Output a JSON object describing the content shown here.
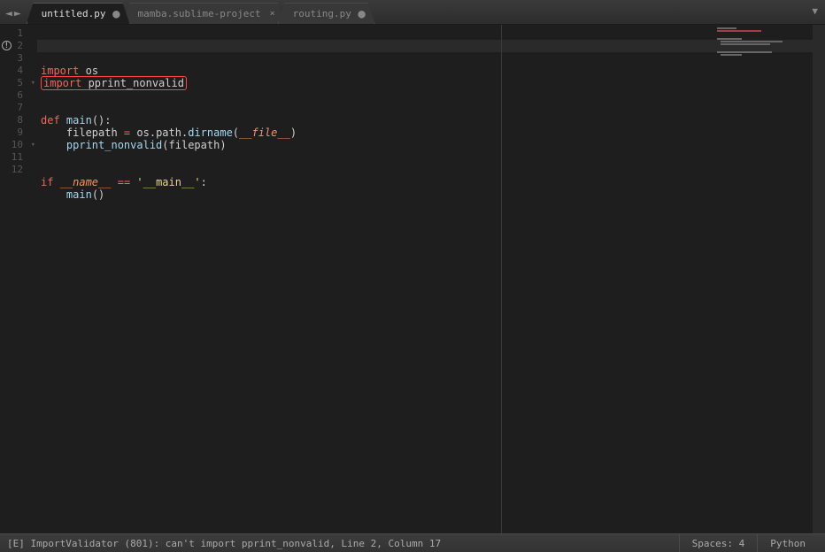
{
  "tabs": [
    {
      "label": "untitled.py",
      "active": true,
      "dirty": true
    },
    {
      "label": "mamba.sublime-project",
      "active": false,
      "dirty": false
    },
    {
      "label": "routing.py",
      "active": false,
      "dirty": true
    }
  ],
  "gutter": {
    "lines": [
      "1",
      "2",
      "3",
      "4",
      "5",
      "6",
      "7",
      "8",
      "9",
      "10",
      "11",
      "12"
    ],
    "error_line": 2
  },
  "code": {
    "active_line": 2,
    "tokens": [
      [
        {
          "t": "import",
          "c": "kw"
        },
        {
          "t": " ",
          "c": ""
        },
        {
          "t": "os",
          "c": "nm"
        }
      ],
      [
        {
          "t": "import pprint_nonvalid",
          "c": "err"
        }
      ],
      [],
      [],
      [
        {
          "t": "def",
          "c": "kw"
        },
        {
          "t": " ",
          "c": ""
        },
        {
          "t": "main",
          "c": "fn"
        },
        {
          "t": "()",
          "c": "paren"
        },
        {
          "t": ":",
          "c": "punct"
        }
      ],
      [
        {
          "t": "    filepath ",
          "c": "nm"
        },
        {
          "t": "=",
          "c": "op"
        },
        {
          "t": " os",
          "c": "nm"
        },
        {
          "t": ".",
          "c": "punct"
        },
        {
          "t": "path",
          "c": "nm"
        },
        {
          "t": ".",
          "c": "punct"
        },
        {
          "t": "dirname",
          "c": "fn"
        },
        {
          "t": "(",
          "c": "paren"
        },
        {
          "t": "__file__",
          "c": "var"
        },
        {
          "t": ")",
          "c": "paren"
        }
      ],
      [
        {
          "t": "    ",
          "c": ""
        },
        {
          "t": "pprint_nonvalid",
          "c": "fn"
        },
        {
          "t": "(",
          "c": "paren"
        },
        {
          "t": "filepath",
          "c": "nm"
        },
        {
          "t": ")",
          "c": "paren"
        }
      ],
      [],
      [],
      [
        {
          "t": "if",
          "c": "kw"
        },
        {
          "t": " ",
          "c": ""
        },
        {
          "t": "__name__",
          "c": "var"
        },
        {
          "t": " ",
          "c": ""
        },
        {
          "t": "==",
          "c": "op"
        },
        {
          "t": " ",
          "c": ""
        },
        {
          "t": "'__main__'",
          "c": "str"
        },
        {
          "t": ":",
          "c": "punct"
        }
      ],
      [
        {
          "t": "    ",
          "c": ""
        },
        {
          "t": "main",
          "c": "fn"
        },
        {
          "t": "()",
          "c": "paren"
        }
      ],
      []
    ],
    "fold_lines": [
      5,
      10
    ]
  },
  "status": {
    "message": "[E] ImportValidator (801): can't import pprint_nonvalid, Line 2, Column 17",
    "spaces": "Spaces: 4",
    "syntax": "Python"
  }
}
